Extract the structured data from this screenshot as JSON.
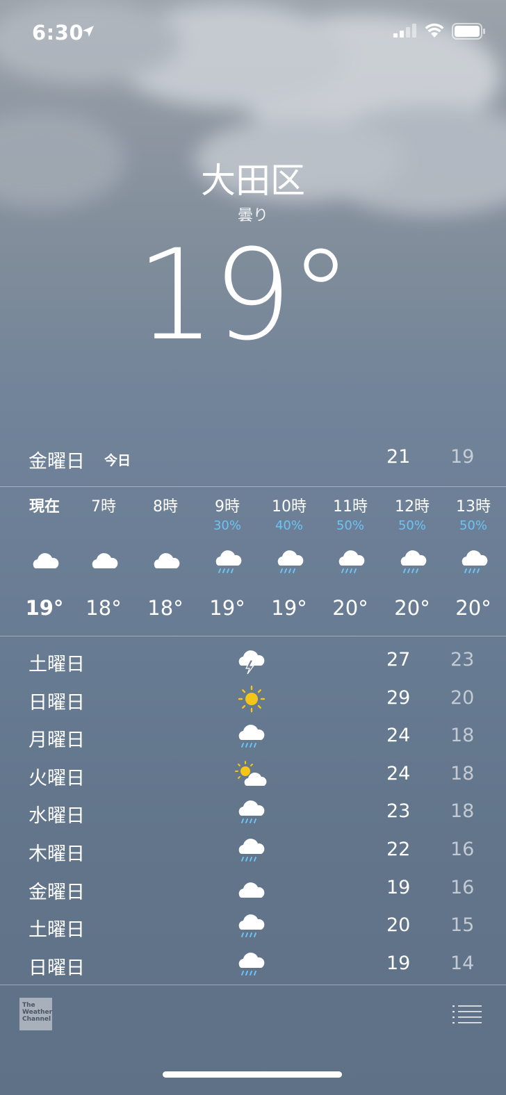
{
  "status_bar": {
    "time": "6:30"
  },
  "location": {
    "city": "大田区",
    "condition": "曇り",
    "temperature": "19°"
  },
  "today": {
    "day": "金曜日",
    "tag": "今日",
    "high": "21",
    "low": "19"
  },
  "hourly": [
    {
      "label": "現在",
      "pop": "",
      "icon": "cloud-icon",
      "temp": "19°"
    },
    {
      "label": "7時",
      "pop": "",
      "icon": "cloud-icon",
      "temp": "18°"
    },
    {
      "label": "8時",
      "pop": "",
      "icon": "cloud-icon",
      "temp": "18°"
    },
    {
      "label": "9時",
      "pop": "30%",
      "icon": "rain-cloud-icon",
      "temp": "19°"
    },
    {
      "label": "10時",
      "pop": "40%",
      "icon": "rain-cloud-icon",
      "temp": "19°"
    },
    {
      "label": "11時",
      "pop": "50%",
      "icon": "rain-cloud-icon",
      "temp": "20°"
    },
    {
      "label": "12時",
      "pop": "50%",
      "icon": "rain-cloud-icon",
      "temp": "20°"
    },
    {
      "label": "13時",
      "pop": "50%",
      "icon": "rain-cloud-icon",
      "temp": "20°"
    }
  ],
  "daily": [
    {
      "day": "土曜日",
      "icon": "thunderstorm-icon",
      "high": "27",
      "low": "23"
    },
    {
      "day": "日曜日",
      "icon": "sun-icon",
      "high": "29",
      "low": "20"
    },
    {
      "day": "月曜日",
      "icon": "rain-cloud-icon",
      "high": "24",
      "low": "18"
    },
    {
      "day": "火曜日",
      "icon": "partly-cloudy-icon",
      "high": "24",
      "low": "18"
    },
    {
      "day": "水曜日",
      "icon": "rain-cloud-icon",
      "high": "23",
      "low": "18"
    },
    {
      "day": "木曜日",
      "icon": "rain-cloud-icon",
      "high": "22",
      "low": "16"
    },
    {
      "day": "金曜日",
      "icon": "cloud-icon",
      "high": "19",
      "low": "16"
    },
    {
      "day": "土曜日",
      "icon": "rain-cloud-icon",
      "high": "20",
      "low": "15"
    },
    {
      "day": "日曜日",
      "icon": "rain-cloud-icon",
      "high": "19",
      "low": "14"
    }
  ],
  "footer": {
    "provider_logo_text": "The Weather Channel"
  },
  "colors": {
    "precip": "#6cc3f4",
    "sun": "#f5c518",
    "low_temp": "#c3cad3"
  }
}
